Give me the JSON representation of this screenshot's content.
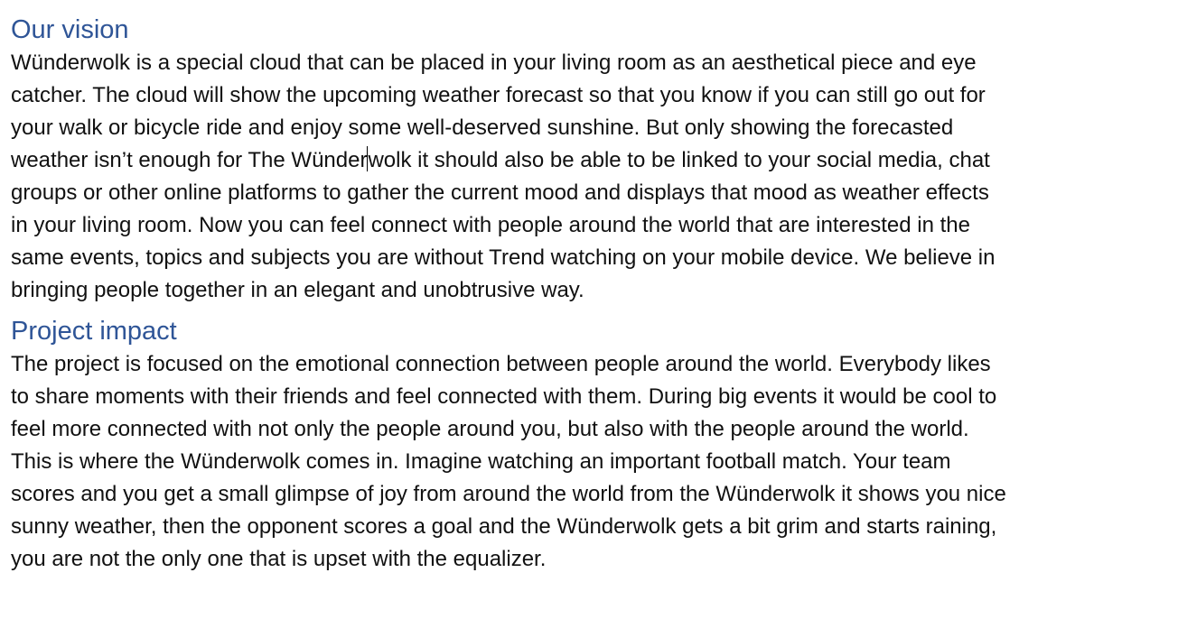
{
  "sections": [
    {
      "heading": "Our vision",
      "lines": [
        "Wünderwolk is a special cloud that can be placed in your living room as an aesthetical piece and eye",
        "catcher. The cloud will show the upcoming weather forecast so that you know if you can still go out for",
        "your walk or bicycle ride and enjoy some well-deserved sunshine. But only showing the forecasted",
        "weather isn’t enough for The Wünderwolk it should also be able to be linked to your social media, chat",
        "groups or other online platforms to gather the current mood and displays that mood as weather effects",
        "in your living room. Now you can feel connect with people around the world that are interested in the",
        "same events, topics and subjects you are without Trend watching on your mobile device. We believe in",
        "bringing people together in an elegant and unobtrusive way."
      ],
      "caret_line_parts": [
        "weather isn’t enough for The Wünder",
        "wolk it should also be able to be linked to your social media, chat"
      ]
    },
    {
      "heading": "Project impact",
      "lines": [
        "The project is focused on the emotional connection between people around the world. Everybody likes",
        "to share moments with their friends and feel connected with them. During big events it would be cool to",
        "feel more connected with not only the people around you, but also with the people around the world.",
        "This is where the Wünderwolk comes in. Imagine watching an important football match. Your team",
        "scores and you get a small glimpse of joy from around the world from the Wünderwolk it shows you nice",
        "sunny weather, then the opponent scores a goal and the Wünderwolk gets a bit grim and starts raining,",
        "you are not the only one that is upset with the equalizer."
      ]
    }
  ]
}
